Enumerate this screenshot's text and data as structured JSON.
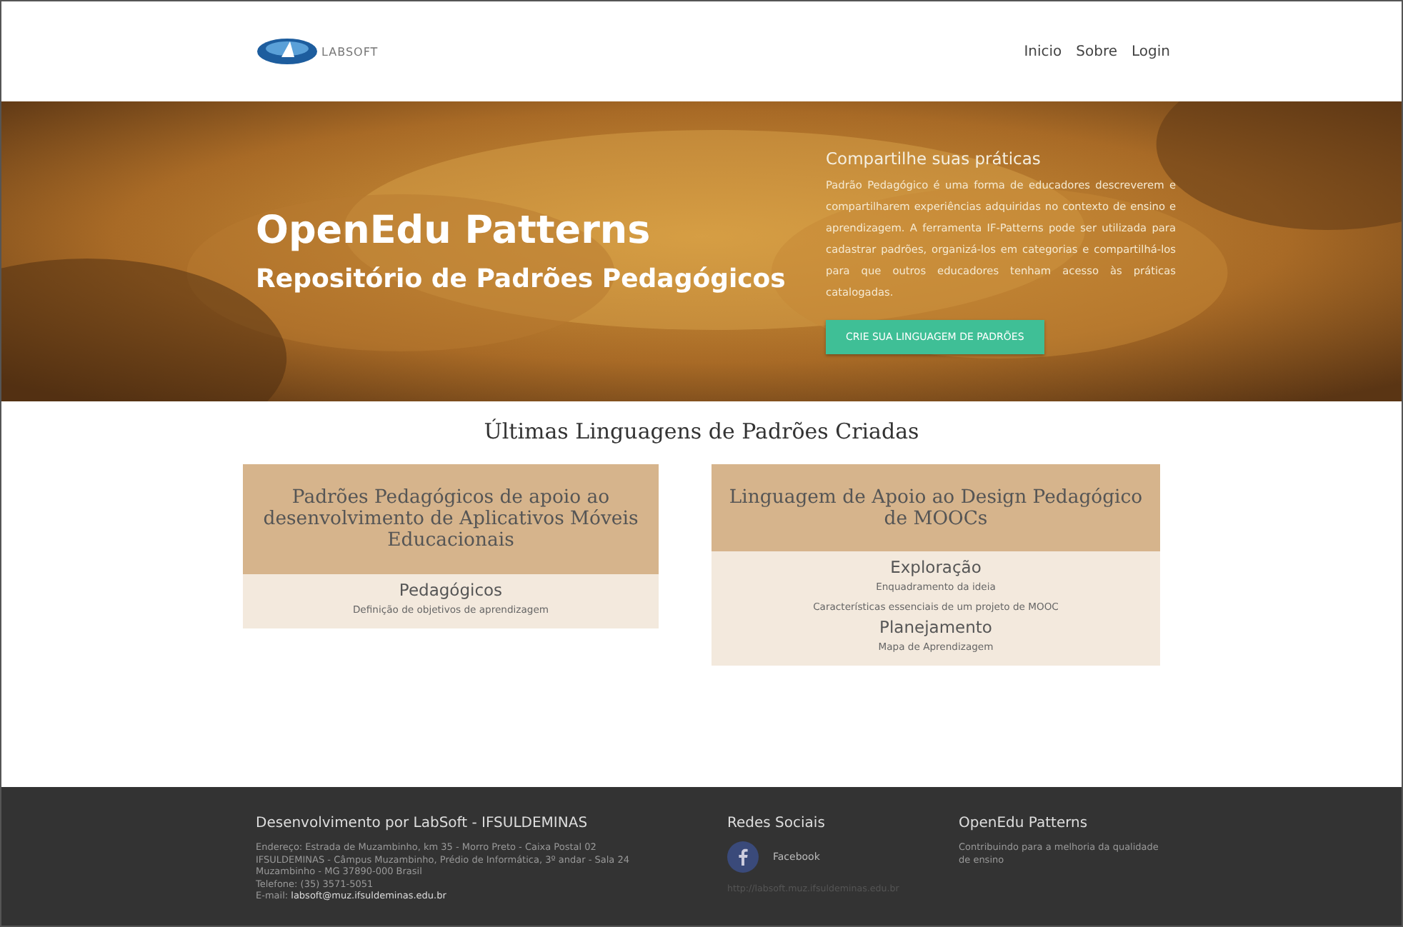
{
  "header": {
    "logo_text": "LABSOFT",
    "nav": [
      {
        "label": "Inicio"
      },
      {
        "label": "Sobre"
      },
      {
        "label": "Login"
      }
    ]
  },
  "hero": {
    "title": "OpenEdu Patterns",
    "subtitle": "Repositório de Padrões Pedagógicos",
    "side_title": "Compartilhe suas práticas",
    "description": "Padrão Pedagógico é uma forma de educadores descreverem e compartilharem experiências adquiridas no contexto de ensino e aprendizagem. A ferramenta IF-Patterns pode ser utilizada para cadastrar padrões, organizá-los em categorias e compartilhá-los para que outros educadores tenham acesso às práticas catalogadas.",
    "button": "CRIE SUA LINGUAGEM DE PADRÕES"
  },
  "languages": {
    "title": "Últimas Linguagens de Padrões Criadas",
    "cards": [
      {
        "title": "Padrões Pedagógicos de apoio ao desenvolvimento de Aplicativos Móveis Educacionais",
        "categories": [
          {
            "name": "Pedagógicos",
            "patterns": [
              "Definição de objetivos de aprendizagem"
            ]
          }
        ]
      },
      {
        "title": "Linguagem de Apoio ao Design Pedagógico de MOOCs",
        "categories": [
          {
            "name": "Exploração",
            "patterns": [
              "Enquadramento da ideia",
              "Características essenciais de um projeto de MOOC"
            ]
          },
          {
            "name": "Planejamento",
            "patterns": [
              "Mapa de Aprendizagem"
            ]
          }
        ]
      }
    ]
  },
  "footer": {
    "about": {
      "title": "Desenvolvimento por LabSoft - IFSULDEMINAS",
      "lines": [
        "Endereço: Estrada de Muzambinho, km 35 - Morro Preto - Caixa Postal 02",
        "IFSULDEMINAS - Câmpus Muzambinho, Prédio de Informática, 3º andar - Sala 24",
        "Muzambinho - MG 37890-000 Brasil",
        "Telefone: (35) 3571-5051",
        "E-mail: **labsoft@muz.ifsuldeminas.edu.br**"
      ]
    },
    "social": {
      "title": "Redes Sociais",
      "links": [
        {
          "label": "Facebook"
        }
      ],
      "url": "http://labsoft.muz.ifsuldeminas.edu.br"
    },
    "project": {
      "title": "OpenEdu Patterns",
      "text": "Contribuindo para a melhoria da qualidade de ensino"
    }
  }
}
